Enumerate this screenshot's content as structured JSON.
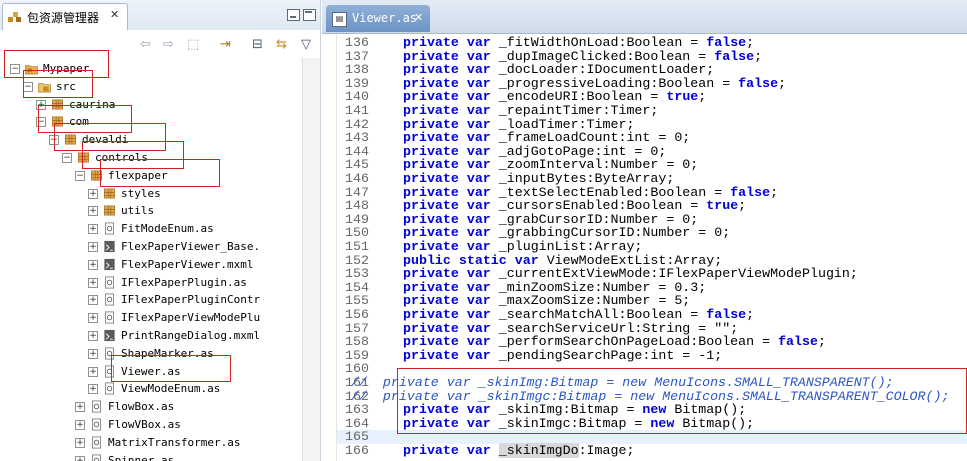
{
  "left_panel": {
    "tab_label": "包资源管理器",
    "tab_close": "✕",
    "tree": [
      {
        "label": "Mypaper",
        "icon": "project-folder-icon",
        "expander": "⊟"
      },
      {
        "label": "src",
        "icon": "source-folder-icon",
        "expander": "⊟"
      },
      {
        "label": "caurina",
        "icon": "package-icon",
        "expander": "⊞"
      },
      {
        "label": "com",
        "icon": "package-icon",
        "expander": "⊟"
      },
      {
        "label": "devaldi",
        "icon": "package-icon",
        "expander": "⊟"
      },
      {
        "label": "controls",
        "icon": "package-icon",
        "expander": "⊟"
      },
      {
        "label": "flexpaper",
        "icon": "package-icon",
        "expander": "⊟"
      },
      {
        "label": "styles",
        "icon": "package-icon",
        "expander": "⊞"
      },
      {
        "label": "utils",
        "icon": "package-icon",
        "expander": "⊞"
      },
      {
        "label": "FitModeEnum.as",
        "icon": "as-file-icon",
        "expander": "⊞"
      },
      {
        "label": "FlexPaperViewer_Base.",
        "icon": "mxml-file-icon",
        "expander": "⊞"
      },
      {
        "label": "FlexPaperViewer.mxml",
        "icon": "mxml-file-icon",
        "expander": "⊞"
      },
      {
        "label": "IFlexPaperPlugin.as",
        "icon": "as-file-icon",
        "expander": "⊞"
      },
      {
        "label": "IFlexPaperPluginContr",
        "icon": "as-file-icon",
        "expander": "⊞"
      },
      {
        "label": "IFlexPaperViewModePlu",
        "icon": "as-file-icon",
        "expander": "⊞"
      },
      {
        "label": "PrintRangeDialog.mxml",
        "icon": "mxml-file-icon",
        "expander": "⊞"
      },
      {
        "label": "ShapeMarker.as",
        "icon": "as-file-icon",
        "expander": "⊞"
      },
      {
        "label": "Viewer.as",
        "icon": "as-file-icon",
        "expander": "⊞"
      },
      {
        "label": "ViewModeEnum.as",
        "icon": "as-file-icon",
        "expander": "⊞"
      },
      {
        "label": "FlowBox.as",
        "icon": "as-file-icon",
        "expander": "⊞"
      },
      {
        "label": "FlowVBox.as",
        "icon": "as-file-icon",
        "expander": "⊞"
      },
      {
        "label": "MatrixTransformer.as",
        "icon": "as-file-icon",
        "expander": "⊞"
      },
      {
        "label": "Spinner.as",
        "icon": "as-file-icon",
        "expander": "⊞"
      }
    ]
  },
  "editor": {
    "tab_label": "Viewer.as",
    "tab_close": "✕",
    "lines": [
      {
        "n": "136",
        "kind": "priv",
        "rest": "_fitWidthOnLoad:Boolean = ",
        "val": "false",
        "end": ";"
      },
      {
        "n": "137",
        "kind": "priv",
        "rest": "_dupImageClicked:Boolean = ",
        "val": "false",
        "end": ";"
      },
      {
        "n": "138",
        "kind": "priv",
        "rest": "_docLoader:IDocumentLoader;",
        "val": "",
        "end": ""
      },
      {
        "n": "139",
        "kind": "priv",
        "rest": "_progressiveLoading:Boolean = ",
        "val": "false",
        "end": ";"
      },
      {
        "n": "140",
        "kind": "priv",
        "rest": "_encodeURI:Boolean = ",
        "val": "true",
        "end": ";"
      },
      {
        "n": "141",
        "kind": "priv",
        "rest": "_repaintTimer:Timer;",
        "val": "",
        "end": ""
      },
      {
        "n": "142",
        "kind": "priv",
        "rest": "_loadTimer:Timer;",
        "val": "",
        "end": ""
      },
      {
        "n": "143",
        "kind": "priv",
        "rest": "_frameLoadCount:int = 0;",
        "val": "",
        "end": ""
      },
      {
        "n": "144",
        "kind": "priv",
        "rest": "_adjGotoPage:int = 0;",
        "val": "",
        "end": ""
      },
      {
        "n": "145",
        "kind": "priv",
        "rest": "_zoomInterval:Number = 0;",
        "val": "",
        "end": ""
      },
      {
        "n": "146",
        "kind": "priv",
        "rest": "_inputBytes:ByteArray;",
        "val": "",
        "end": ""
      },
      {
        "n": "147",
        "kind": "priv",
        "rest": "_textSelectEnabled:Boolean = ",
        "val": "false",
        "end": ";"
      },
      {
        "n": "148",
        "kind": "priv",
        "rest": "_cursorsEnabled:Boolean = ",
        "val": "true",
        "end": ";"
      },
      {
        "n": "149",
        "kind": "priv",
        "rest": "_grabCursorID:Number = 0;",
        "val": "",
        "end": ""
      },
      {
        "n": "150",
        "kind": "priv",
        "rest": "_grabbingCursorID:Number = 0;",
        "val": "",
        "end": ""
      },
      {
        "n": "151",
        "kind": "priv",
        "rest": "_pluginList:Array;",
        "val": "",
        "end": ""
      },
      {
        "n": "152",
        "kind": "pubstatic",
        "rest": "ViewModeExtList:Array;",
        "val": "",
        "end": ""
      },
      {
        "n": "153",
        "kind": "priv",
        "rest": "_currentExtViewMode:IFlexPaperViewModePlugin;",
        "val": "",
        "end": ""
      },
      {
        "n": "154",
        "kind": "priv",
        "rest": "_minZoomSize:Number = 0.3;",
        "val": "",
        "end": ""
      },
      {
        "n": "155",
        "kind": "priv",
        "rest": "_maxZoomSize:Number = 5;",
        "val": "",
        "end": ""
      },
      {
        "n": "156",
        "kind": "priv",
        "rest": "_searchMatchAll:Boolean = ",
        "val": "false",
        "end": ";"
      },
      {
        "n": "157",
        "kind": "priv",
        "rest": "_searchServiceUrl:String = ",
        "val": "\"\"",
        "end": ";"
      },
      {
        "n": "158",
        "kind": "priv",
        "rest": "_performSearchOnPageLoad:Boolean = ",
        "val": "false",
        "end": ";"
      },
      {
        "n": "159",
        "kind": "priv",
        "rest": "_pendingSearchPage:int = -1;",
        "val": "",
        "end": ""
      },
      {
        "n": "160",
        "kind": "blank",
        "rest": "",
        "val": "",
        "end": ""
      },
      {
        "n": "161",
        "kind": "comment",
        "rest": "//  private var _skinImg:Bitmap = new MenuIcons.SMALL_TRANSPARENT();",
        "val": "",
        "end": ""
      },
      {
        "n": "162",
        "kind": "comment",
        "rest": "//  private var _skinImgc:Bitmap = new MenuIcons.SMALL_TRANSPARENT_COLOR();",
        "val": "",
        "end": ""
      },
      {
        "n": "163",
        "kind": "privnew",
        "rest": "_skinImg:Bitmap = ",
        "val": "new",
        "end": " Bitmap();"
      },
      {
        "n": "164",
        "kind": "privnew",
        "rest": "_skinImgc:Bitmap = ",
        "val": "new",
        "end": " Bitmap();"
      },
      {
        "n": "165",
        "kind": "blank",
        "rest": "",
        "val": "",
        "end": ""
      },
      {
        "n": "166",
        "kind": "privhl",
        "rest": "_skinImgDo",
        "val": "",
        "end": ":Image;"
      }
    ]
  }
}
